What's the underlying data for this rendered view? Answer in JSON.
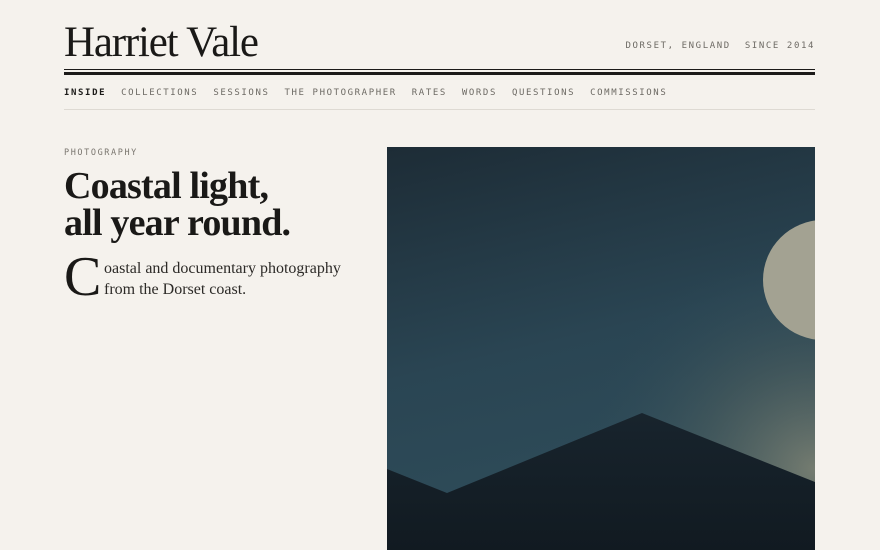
{
  "header": {
    "title": "Harriet Vale",
    "tagline": "DORSET, ENGLAND  SINCE 2014"
  },
  "nav": {
    "items": [
      {
        "label": "INSIDE",
        "active": true
      },
      {
        "label": "COLLECTIONS",
        "active": false
      },
      {
        "label": "SESSIONS",
        "active": false
      },
      {
        "label": "THE PHOTOGRAPHER",
        "active": false
      },
      {
        "label": "RATES",
        "active": false
      },
      {
        "label": "WORDS",
        "active": false
      },
      {
        "label": "QUESTIONS",
        "active": false
      },
      {
        "label": "COMMISSIONS",
        "active": false
      }
    ]
  },
  "hero": {
    "eyebrow": "PHOTOGRAPHY",
    "headline_line1": "Coastal light,",
    "headline_line2": "all year round.",
    "dropcap": "C",
    "intro": "oastal and documentary photography from the Dorset coast."
  },
  "colors": {
    "background": "#f5f2ed",
    "ink": "#1c1b19",
    "muted": "#6d6a64",
    "sky_top": "#1f2e38",
    "sky_bottom": "#2d4a58",
    "moon": "#a3a292",
    "mountain": "#16212a"
  }
}
